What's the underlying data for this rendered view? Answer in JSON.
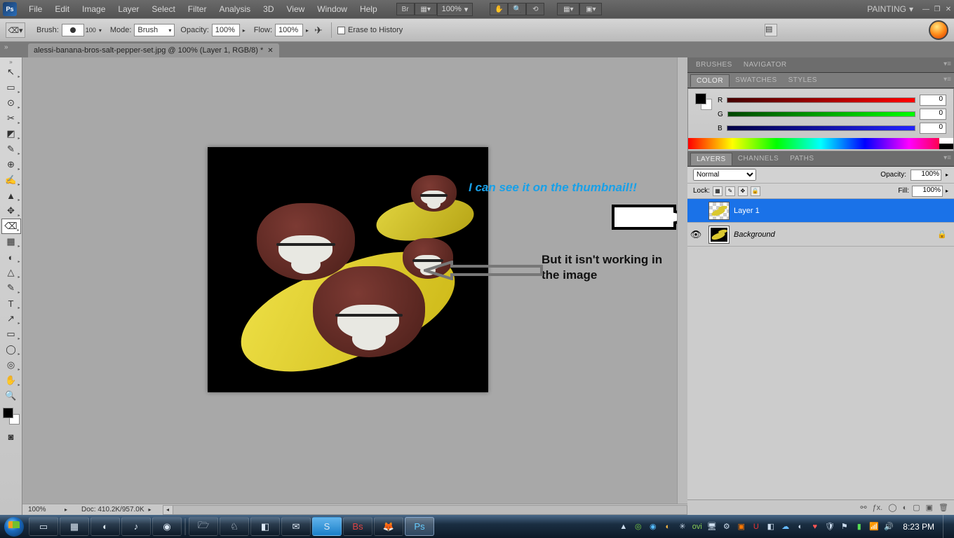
{
  "menu": [
    "File",
    "Edit",
    "Image",
    "Layer",
    "Select",
    "Filter",
    "Analysis",
    "3D",
    "View",
    "Window",
    "Help"
  ],
  "zoom_display": "100%",
  "workspace": "PAINTING",
  "options": {
    "brush_label": "Brush:",
    "brush_size": "100",
    "mode_label": "Mode:",
    "mode_value": "Brush",
    "opacity_label": "Opacity:",
    "opacity_value": "100%",
    "flow_label": "Flow:",
    "flow_value": "100%",
    "erase_label": "Erase to History"
  },
  "doc_tab": "alessi-banana-bros-salt-pepper-set.jpg @ 100% (Layer 1, RGB/8) *",
  "annotations": {
    "blue": "I can see it on the thumbnail!!",
    "black": "But it isn't working in the image"
  },
  "status": {
    "zoom": "100%",
    "doc": "Doc: 410.2K/957.0K"
  },
  "panel_tabs": {
    "nav": [
      "BRUSHES",
      "NAVIGATOR"
    ],
    "color": [
      "COLOR",
      "SWATCHES",
      "STYLES"
    ],
    "layers": [
      "LAYERS",
      "CHANNELS",
      "PATHS"
    ]
  },
  "color": {
    "r": "0",
    "g": "0",
    "b": "0",
    "r_label": "R",
    "g_label": "G",
    "b_label": "B"
  },
  "layers_panel": {
    "blend": "Normal",
    "opacity_label": "Opacity:",
    "opacity": "100%",
    "lock_label": "Lock:",
    "fill_label": "Fill:",
    "fill": "100%",
    "layers": [
      {
        "name": "Layer 1",
        "selected": true,
        "visible": false,
        "bg": false
      },
      {
        "name": "Background",
        "selected": false,
        "visible": true,
        "bg": true
      }
    ]
  },
  "clock": "8:23 PM",
  "tools": [
    "↖",
    "▭",
    "⊙",
    "✂",
    "◩",
    "✎",
    "⌖",
    "⊕",
    "✍",
    "✥",
    "⌫",
    "▦",
    "◐",
    "△",
    "✎",
    "T",
    "↗",
    "▭",
    "◯",
    "✋",
    "🔍"
  ]
}
